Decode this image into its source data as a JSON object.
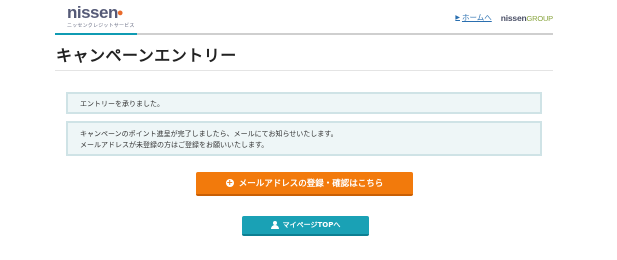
{
  "header": {
    "logo_text": "nissen",
    "logo_mark": "●",
    "logo_subtitle": "ニッセンクレジットサービス",
    "home_arrow": "▶",
    "home_link": "ホームへ",
    "group_logo_main": "nissen",
    "group_logo_suffix": "GROUP"
  },
  "page": {
    "title": "キャンペーンエントリー"
  },
  "messages": {
    "entry_received": "エントリーを承りました。",
    "notice_line1": "キャンペーンのポイント進呈が完了しましたら、メールにてお知らせいたします。",
    "notice_line2": "メールアドレスが未登録の方はご登録をお願いいたします。"
  },
  "buttons": {
    "mail_register_label": "メールアドレスの登録・確認はこちら",
    "mail_register_icon": "+",
    "mypage_top_label": "マイページTOPへ"
  },
  "colors": {
    "accent": "#0f9bb3",
    "orange_button": "#f27a0c",
    "teal_button": "#1aa1b5",
    "message_bg": "#eef6f7"
  }
}
